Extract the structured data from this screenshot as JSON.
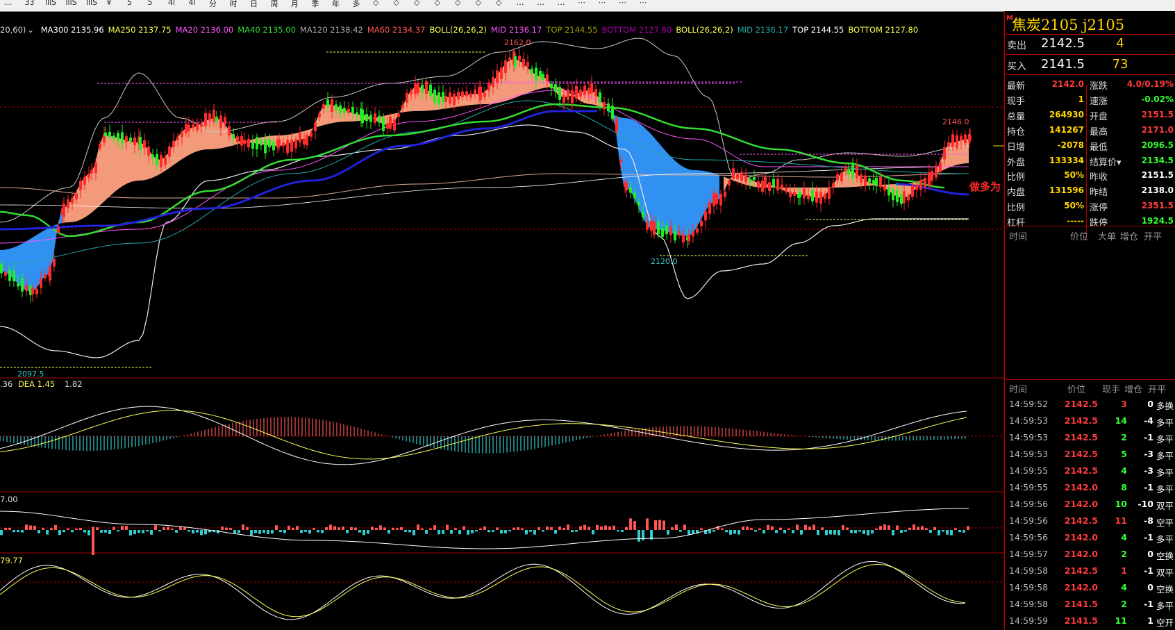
{
  "toolbar": {
    "items": [
      "…",
      "33",
      "lllS",
      "lllS",
      "lllS",
      "¥",
      "5",
      "5",
      "4l",
      "4l",
      "分",
      "时",
      "日",
      "周",
      "月",
      "季",
      "年",
      "多",
      "◇",
      "◇",
      "◇",
      "◇",
      "◇",
      "◇",
      "◇",
      "…",
      "…",
      "…",
      "⋯",
      "⋯",
      "⋯",
      "⋯"
    ]
  },
  "indicators": {
    "prefix": "20,60)",
    "items": [
      {
        "text": "MA300 2135.96",
        "color": "#ffffff"
      },
      {
        "text": "MA250 2137.75",
        "color": "#ffff55"
      },
      {
        "text": "MA20 2136.00",
        "color": "#ff55ff"
      },
      {
        "text": "MA40 2135.00",
        "color": "#33dd33"
      },
      {
        "text": "MA120 2138.42",
        "color": "#aaaaaa"
      },
      {
        "text": "MA60 2134.37",
        "color": "#ff5555"
      },
      {
        "text": "BOLL(26,26,2)",
        "color": "#ffff55"
      },
      {
        "text": "MID 2136.17",
        "color": "#ff55ff"
      },
      {
        "text": "TOP 2144.55",
        "color": "#a0a000"
      },
      {
        "text": "BOTTOM 2127.80",
        "color": "#aa00aa"
      },
      {
        "text": "BOLL(26,26,2)",
        "color": "#ffff55"
      },
      {
        "text": "MID 2136.17",
        "color": "#22aaaa"
      },
      {
        "text": "TOP 2144.55",
        "color": "#ffffff"
      },
      {
        "text": "BOTTOM 2127.80",
        "color": "#ffff55"
      }
    ]
  },
  "price_labels": {
    "high": "2162.0",
    "low_mid": "2120.0",
    "low_left": "2097.5",
    "recent_high": "2146.0",
    "signal": "做多为"
  },
  "macd_label": {
    "prefix": ".36",
    "dea": "DEA 1.45",
    "value": "1.82"
  },
  "vol_label": "7.00",
  "kdj_label": "79.77",
  "panel": {
    "title": "焦炭2105  j2105",
    "marker": "M",
    "sell": {
      "label": "卖出",
      "price": "2142.5",
      "vol": "4"
    },
    "buy": {
      "label": "买入",
      "price": "2141.5",
      "vol": "73"
    },
    "stats": [
      {
        "l1": "最新",
        "v1": "2142.0",
        "c1": "#ff3b3b",
        "l2": "涨跌",
        "v2": "4.0/0.19%",
        "c2": "#ff3b3b"
      },
      {
        "l1": "现手",
        "v1": "1",
        "c1": "#ffd400",
        "l2": "速涨",
        "v2": "-0.02%",
        "c2": "#33ff33"
      },
      {
        "l1": "总量",
        "v1": "264930",
        "c1": "#ffd400",
        "l2": "开盘",
        "v2": "2151.5",
        "c2": "#ff3b3b"
      },
      {
        "l1": "持仓",
        "v1": "141267",
        "c1": "#ffd400",
        "l2": "最高",
        "v2": "2171.0",
        "c2": "#ff3b3b"
      },
      {
        "l1": "日增",
        "v1": "-2078",
        "c1": "#ffd400",
        "l2": "最低",
        "v2": "2096.5",
        "c2": "#33ff33"
      },
      {
        "l1": "外盘",
        "v1": "133334",
        "c1": "#ffd400",
        "l2": "结算价▾",
        "v2": "2134.5",
        "c2": "#33ff33"
      },
      {
        "l1": "比例",
        "v1": "50%",
        "c1": "#ffd400",
        "l2": "昨收",
        "v2": "2151.5",
        "c2": "#ffffff"
      },
      {
        "l1": "内盘",
        "v1": "131596",
        "c1": "#ffd400",
        "l2": "昨结",
        "v2": "2138.0",
        "c2": "#ffffff"
      },
      {
        "l1": "比例",
        "v1": "50%",
        "c1": "#ffd400",
        "l2": "涨停",
        "v2": "2351.5",
        "c2": "#ff3b3b"
      },
      {
        "l1": "杠杆",
        "v1": "-----",
        "c1": "#ffd400",
        "l2": "跌停",
        "v2": "1924.5",
        "c2": "#33ff33"
      }
    ],
    "big_order_header": [
      "时间",
      "价位",
      "大单",
      "增仓",
      "开平"
    ],
    "tick_header": [
      "时间",
      "价位",
      "现手",
      "增仓",
      "开平"
    ],
    "ticks": [
      {
        "time": "14:59:52",
        "price": "2142.5",
        "vol": "3",
        "chg": "0",
        "type": "多换",
        "vc": "#ff3b3b"
      },
      {
        "time": "14:59:53",
        "price": "2142.5",
        "vol": "14",
        "chg": "-4",
        "type": "多平",
        "vc": "#33ff33"
      },
      {
        "time": "14:59:53",
        "price": "2142.5",
        "vol": "2",
        "chg": "-1",
        "type": "多平",
        "vc": "#33ff33"
      },
      {
        "time": "14:59:53",
        "price": "2142.5",
        "vol": "5",
        "chg": "-3",
        "type": "多平",
        "vc": "#33ff33"
      },
      {
        "time": "14:59:55",
        "price": "2142.5",
        "vol": "4",
        "chg": "-3",
        "type": "多平",
        "vc": "#33ff33"
      },
      {
        "time": "14:59:55",
        "price": "2142.0",
        "vol": "8",
        "chg": "-1",
        "type": "多平",
        "vc": "#33ff33"
      },
      {
        "time": "14:59:56",
        "price": "2142.0",
        "vol": "10",
        "chg": "-10",
        "type": "双平",
        "vc": "#33ff33"
      },
      {
        "time": "14:59:56",
        "price": "2142.5",
        "vol": "11",
        "chg": "-8",
        "type": "空平",
        "vc": "#ff3b3b"
      },
      {
        "time": "14:59:56",
        "price": "2142.0",
        "vol": "4",
        "chg": "-1",
        "type": "多平",
        "vc": "#33ff33"
      },
      {
        "time": "14:59:57",
        "price": "2142.0",
        "vol": "2",
        "chg": "0",
        "type": "空换",
        "vc": "#33ff33"
      },
      {
        "time": "14:59:58",
        "price": "2142.5",
        "vol": "1",
        "chg": "-1",
        "type": "双平",
        "vc": "#ff3b3b"
      },
      {
        "time": "14:59:58",
        "price": "2142.0",
        "vol": "4",
        "chg": "0",
        "type": "空换",
        "vc": "#33ff33"
      },
      {
        "time": "14:59:58",
        "price": "2141.5",
        "vol": "2",
        "chg": "-1",
        "type": "多平",
        "vc": "#33ff33"
      },
      {
        "time": "14:59:59",
        "price": "2141.5",
        "vol": "11",
        "chg": "1",
        "type": "空开",
        "vc": "#33ff33"
      }
    ]
  },
  "colors": {
    "up": "#ff2a2a",
    "down": "#22ee22",
    "bull_cloud": "#ffa27f",
    "bear_cloud": "#3399ff",
    "border": "#aa0000"
  }
}
